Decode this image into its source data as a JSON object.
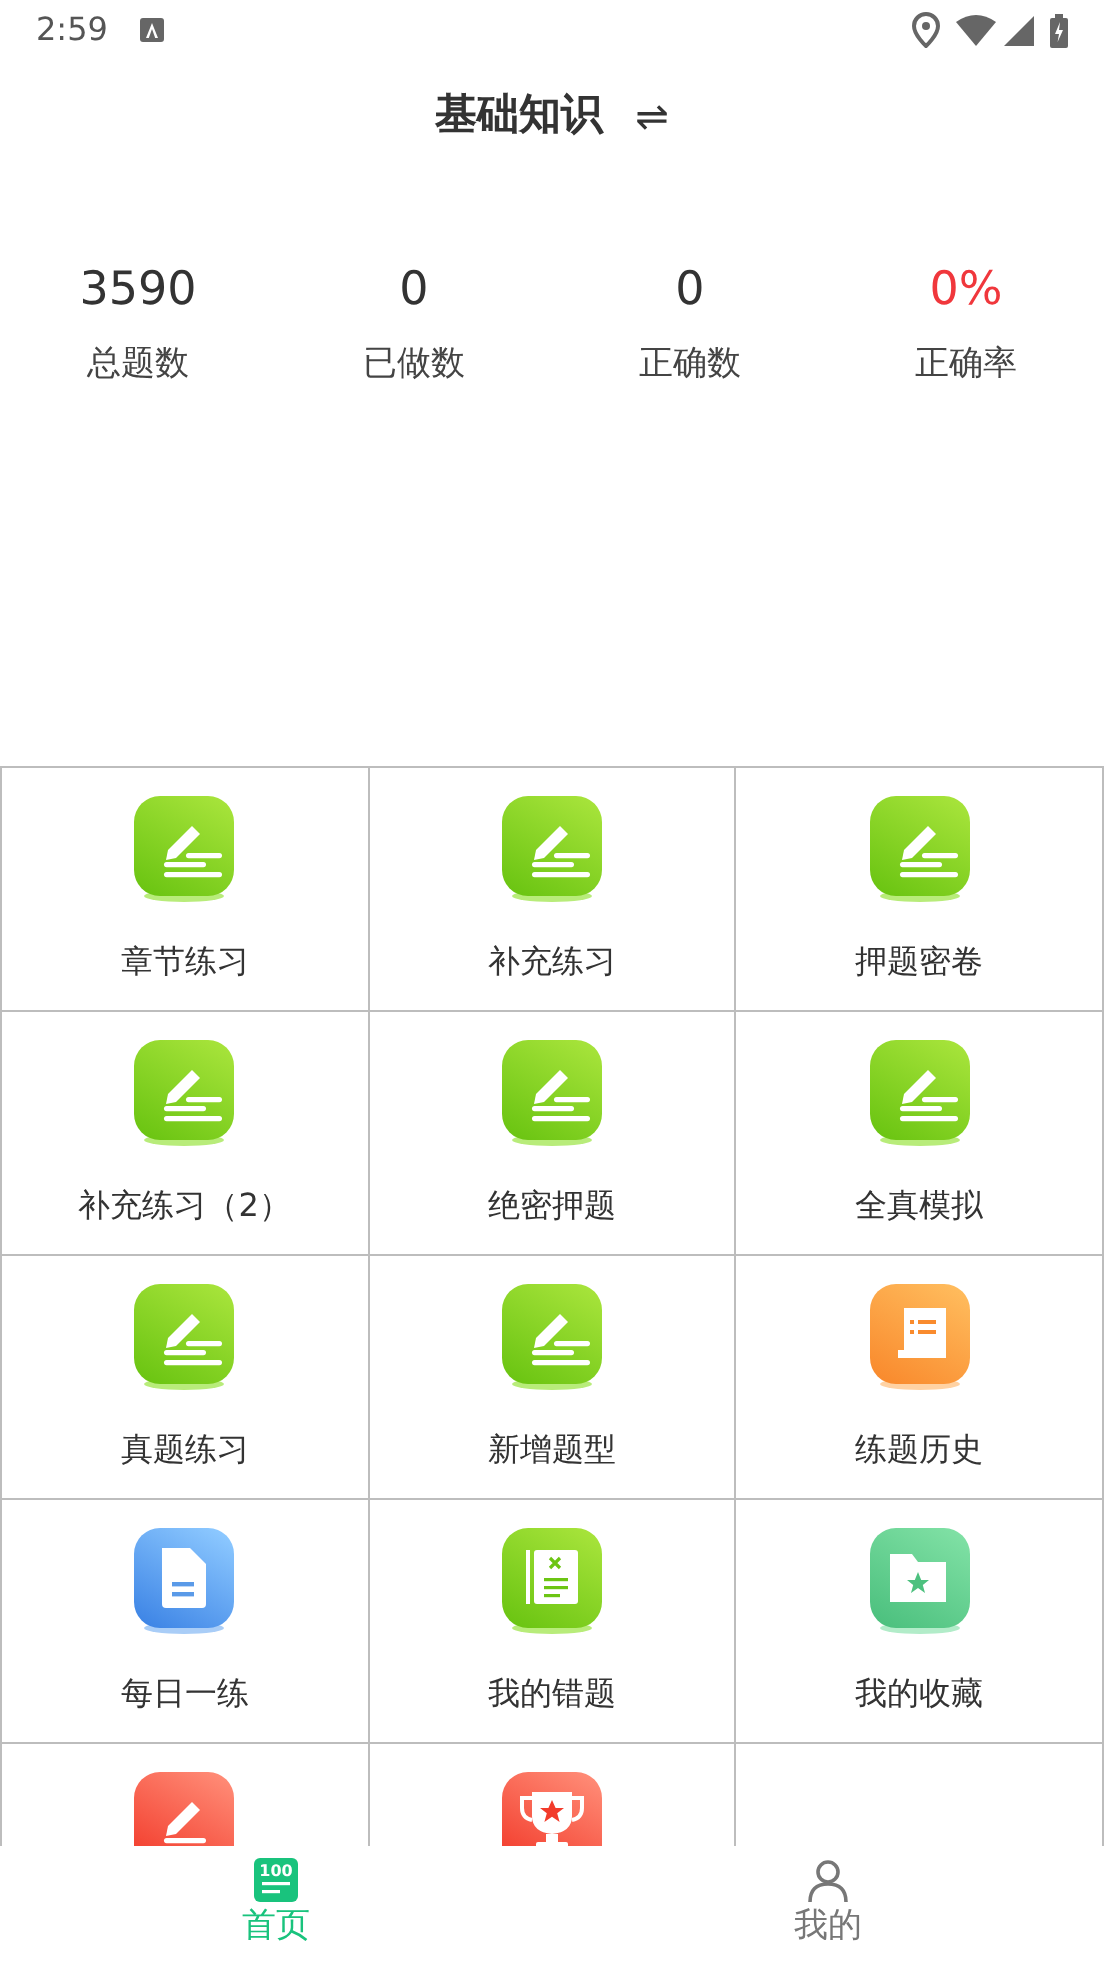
{
  "status_bar": {
    "time": "2:59"
  },
  "header": {
    "title": "基础知识",
    "switch_symbol": "⇌"
  },
  "stats": [
    {
      "value": "3590",
      "label": "总题数",
      "color": "#333333"
    },
    {
      "value": "0",
      "label": "已做数",
      "color": "#333333"
    },
    {
      "value": "0",
      "label": "正确数",
      "color": "#333333"
    },
    {
      "value": "0%",
      "label": "正确率",
      "color": "#f0373c"
    }
  ],
  "grid": [
    {
      "kind": "pencil-green",
      "label": "章节练习"
    },
    {
      "kind": "pencil-green",
      "label": "补充练习"
    },
    {
      "kind": "pencil-green",
      "label": "押题密卷"
    },
    {
      "kind": "pencil-green",
      "label": "补充练习（2）"
    },
    {
      "kind": "pencil-green",
      "label": "绝密押题"
    },
    {
      "kind": "pencil-green",
      "label": "全真模拟"
    },
    {
      "kind": "pencil-green",
      "label": "真题练习"
    },
    {
      "kind": "pencil-green",
      "label": "新增题型"
    },
    {
      "kind": "scroll-orange",
      "label": "练题历史"
    },
    {
      "kind": "doc-blue",
      "label": "每日一练"
    },
    {
      "kind": "wrongbook-green",
      "label": "我的错题"
    },
    {
      "kind": "folder-teal",
      "label": "我的收藏"
    },
    {
      "kind": "pencil-red"
    },
    {
      "kind": "trophy-red"
    },
    {
      "kind": "empty"
    }
  ],
  "bottom_nav": [
    {
      "kind": "home",
      "icon_text": "100",
      "label": "首页",
      "selected": true
    },
    {
      "kind": "profile",
      "label": "我的",
      "selected": false
    }
  ]
}
